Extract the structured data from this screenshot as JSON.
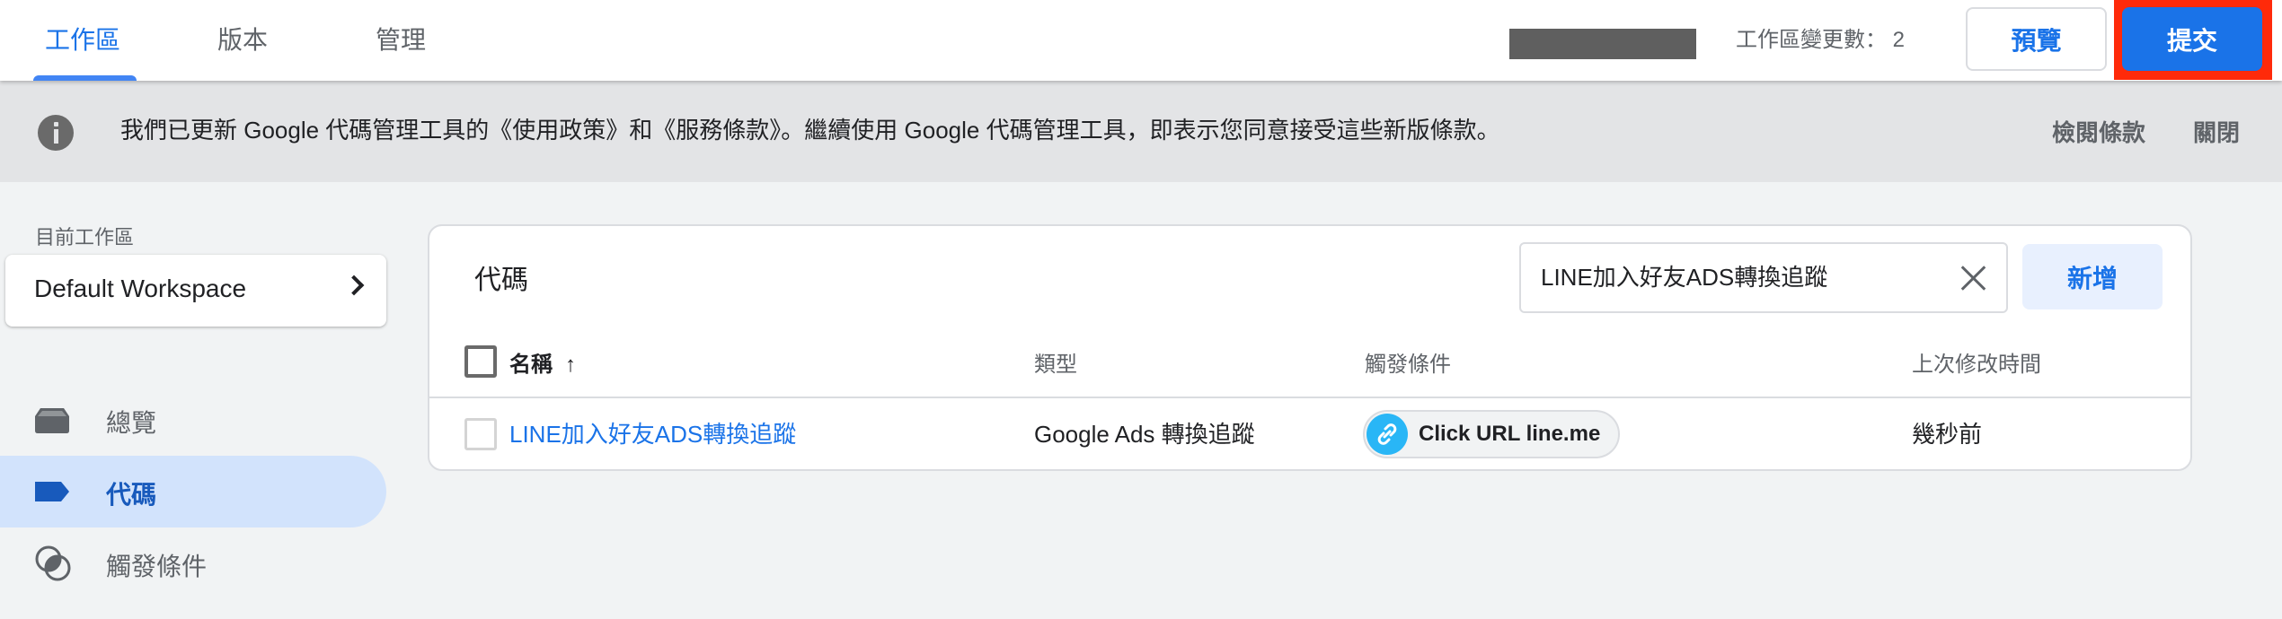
{
  "topbar": {
    "tabs": [
      {
        "label": "工作區",
        "active": true
      },
      {
        "label": "版本",
        "active": false
      },
      {
        "label": "管理",
        "active": false
      }
    ],
    "changes_label": "工作區變更數：",
    "changes_count": "2",
    "preview_label": "預覽",
    "submit_label": "提交",
    "accent_color": "#1a73e8",
    "highlight_color": "#ff2a0a"
  },
  "notice": {
    "icon": "info-icon",
    "text": "我們已更新 Google 代碼管理工具的《使用政策》和《服務條款》。繼續使用 Google 代碼管理工具，即表示您同意接受這些新版條款。",
    "review_label": "檢閱條款",
    "close_label": "關閉"
  },
  "sidebar": {
    "current_workspace_label": "目前工作區",
    "workspace_name": "Default Workspace",
    "items": [
      {
        "label": "總覽",
        "icon": "overview-icon",
        "active": false
      },
      {
        "label": "代碼",
        "icon": "tag-icon",
        "active": true
      },
      {
        "label": "觸發條件",
        "icon": "trigger-icon",
        "active": false
      }
    ]
  },
  "main": {
    "title": "代碼",
    "search": {
      "value": "LINE加入好友ADS轉換追蹤",
      "placeholder": ""
    },
    "add_label": "新增",
    "columns": {
      "name": "名稱",
      "name_sort": "↑",
      "type": "類型",
      "trigger": "觸發條件",
      "modified": "上次修改時間"
    },
    "rows": [
      {
        "name": "LINE加入好友ADS轉換追蹤",
        "type": "Google Ads 轉換追蹤",
        "trigger": "Click URL line.me",
        "trigger_icon": "link-icon",
        "modified": "幾秒前"
      }
    ]
  }
}
